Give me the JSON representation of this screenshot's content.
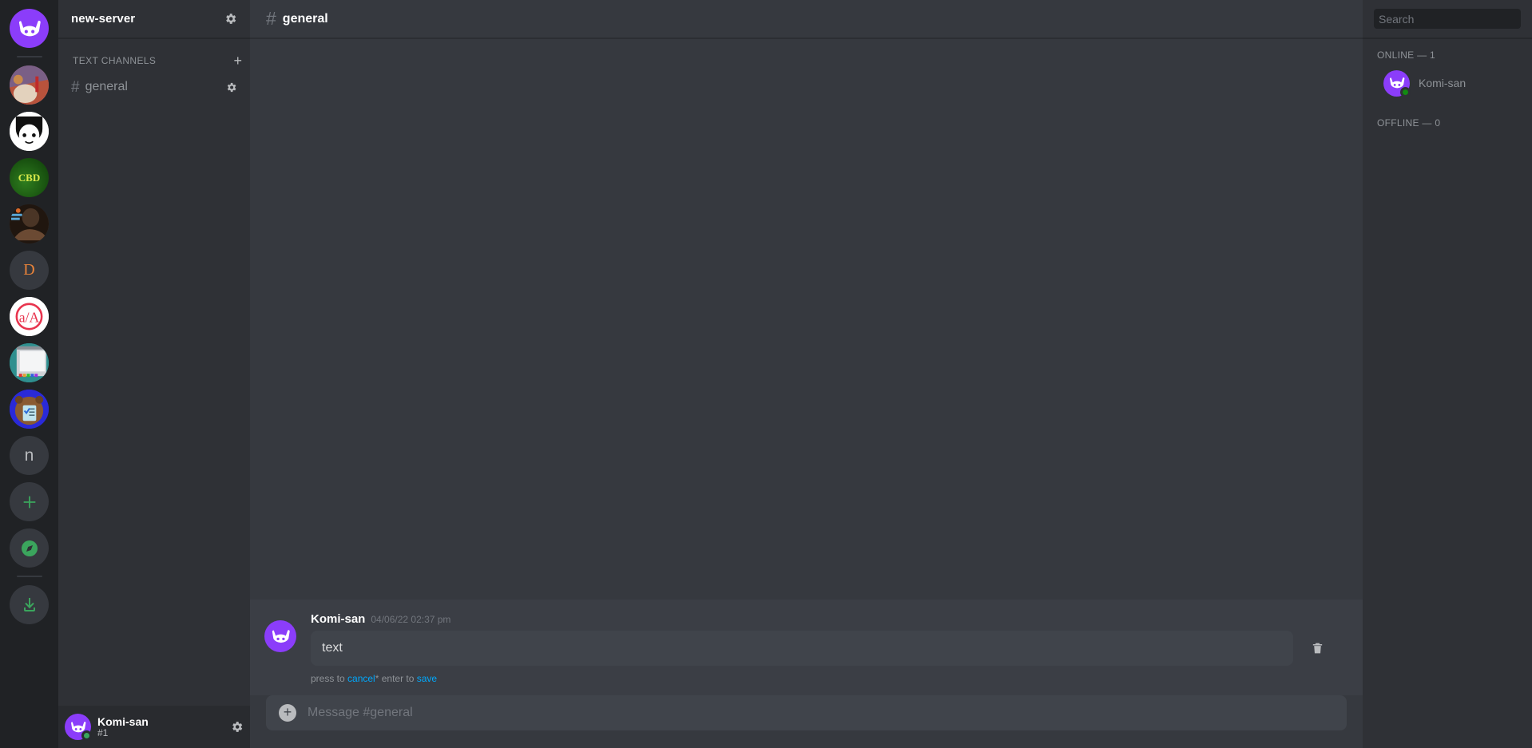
{
  "server_rail": {
    "active_server": "new-server",
    "items": [
      {
        "name": "new-server",
        "icon": "komi-logo",
        "active": true,
        "type": "server"
      },
      {
        "name": "fire-emblem-server",
        "icon": "artwork-thumbnail",
        "active": false,
        "type": "server"
      },
      {
        "name": "manga-server",
        "icon": "manga-thumbnail",
        "active": false,
        "type": "server"
      },
      {
        "name": "cbd-server",
        "icon": "cbd-thumbnail",
        "label": "CBD",
        "active": false,
        "type": "server"
      },
      {
        "name": "person-server",
        "icon": "photo-thumbnail",
        "active": false,
        "type": "server"
      },
      {
        "name": "d-server",
        "icon": "letter-icon",
        "label": "D",
        "active": false,
        "type": "server"
      },
      {
        "name": "aa-server",
        "icon": "aa-logo",
        "label": "a/A",
        "active": false,
        "type": "server"
      },
      {
        "name": "paint-server",
        "icon": "paint-thumbnail",
        "active": false,
        "type": "server"
      },
      {
        "name": "beaver-server",
        "icon": "beaver-thumbnail",
        "active": false,
        "type": "server"
      },
      {
        "name": "n-server",
        "icon": "letter-icon",
        "label": "n",
        "active": false,
        "type": "server"
      },
      {
        "name": "add-server",
        "icon": "plus-icon",
        "label": "+",
        "type": "action"
      },
      {
        "name": "explore-servers",
        "icon": "compass-icon",
        "type": "action"
      },
      {
        "name": "download-apps",
        "icon": "download-icon",
        "type": "action"
      }
    ]
  },
  "sidebar": {
    "server_name": "new-server",
    "settings_icon": "gear-icon",
    "category": {
      "label": "TEXT CHANNELS",
      "add_label": "+"
    },
    "channels": [
      {
        "hash": "#",
        "name": "general",
        "settings_icon": "gear-icon",
        "active": true
      }
    ],
    "user_panel": {
      "name": "Komi-san",
      "tag": "#1",
      "status": "online",
      "settings_icon": "gear-icon"
    }
  },
  "channel_header": {
    "hash": "#",
    "title": "general"
  },
  "message": {
    "author": "Komi-san",
    "timestamp": "04/06/22 02:37 pm",
    "edit_value": "text",
    "hint_prefix": "press to ",
    "hint_cancel": "cancel",
    "hint_middle": "* enter to ",
    "hint_save": "save",
    "delete_icon": "trash-icon"
  },
  "composer": {
    "add_label": "+",
    "placeholder": "Message #general",
    "value": ""
  },
  "members": {
    "search_placeholder": "Search",
    "search_value": "",
    "online_header": "ONLINE — 1",
    "offline_header": "OFFLINE — 0",
    "online": [
      {
        "name": "Komi-san",
        "status": "online"
      }
    ],
    "offline": []
  },
  "colors": {
    "rail_bg": "#202225",
    "sidebar_bg": "#2f3136",
    "chat_bg": "#36393f",
    "input_bg": "#40444b",
    "accent_link": "#00a8fc",
    "online_green": "#3ba55d",
    "brand_purple": "#8b3dfa"
  }
}
